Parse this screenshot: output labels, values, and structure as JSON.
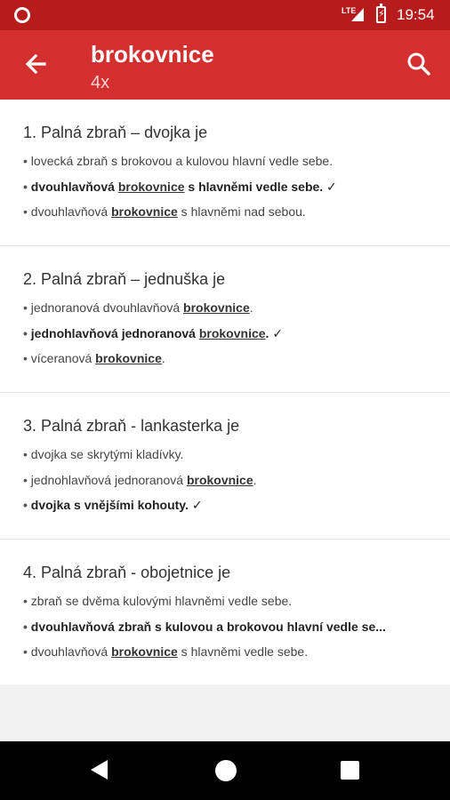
{
  "status": {
    "time": "19:54",
    "network": "LTE"
  },
  "appbar": {
    "title": "brokovnice",
    "subtitle": "4x"
  },
  "colors": {
    "appbar": "#d32f2f",
    "statusbar": "#b71c1c"
  },
  "questions": [
    {
      "title": "1. Palná zbraň – dvojka je",
      "options": [
        {
          "correct": false,
          "parts": [
            "lovecká zbraň s brokovou a kulovou hlavní vedle sebe."
          ]
        },
        {
          "correct": true,
          "parts": [
            "dvouhlavňová ",
            "brokovnice",
            " s hlavněmi vedle sebe. ✓"
          ]
        },
        {
          "correct": false,
          "parts": [
            "dvouhlavňová ",
            "brokovnice",
            " s hlavněmi nad sebou."
          ]
        }
      ]
    },
    {
      "title": "2. Palná zbraň – jednuška je",
      "options": [
        {
          "correct": false,
          "parts": [
            "jednoranová dvouhlavňová ",
            "brokovnice",
            "."
          ]
        },
        {
          "correct": true,
          "parts": [
            "jednohlavňová jednoranová ",
            "brokovnice",
            ". ✓"
          ]
        },
        {
          "correct": false,
          "parts": [
            "víceranová ",
            "brokovnice",
            "."
          ]
        }
      ]
    },
    {
      "title": "3. Palná zbraň - lankasterka je",
      "options": [
        {
          "correct": false,
          "parts": [
            "dvojka se skrytými kladívky."
          ]
        },
        {
          "correct": false,
          "parts": [
            "jednohlavňová jednoranová ",
            "brokovnice",
            "."
          ]
        },
        {
          "correct": true,
          "parts": [
            "dvojka s vnějšími kohouty. ✓"
          ]
        }
      ]
    },
    {
      "title": "4. Palná zbraň - obojetnice je",
      "options": [
        {
          "correct": false,
          "parts": [
            "zbraň se dvěma kulovými hlavněmi vedle sebe."
          ]
        },
        {
          "correct": true,
          "parts": [
            "dvouhlavňová zbraň s kulovou a brokovou hlavní vedle se..."
          ]
        },
        {
          "correct": false,
          "parts": [
            "dvouhlavňová ",
            "brokovnice",
            " s hlavněmi vedle sebe."
          ]
        }
      ]
    }
  ]
}
